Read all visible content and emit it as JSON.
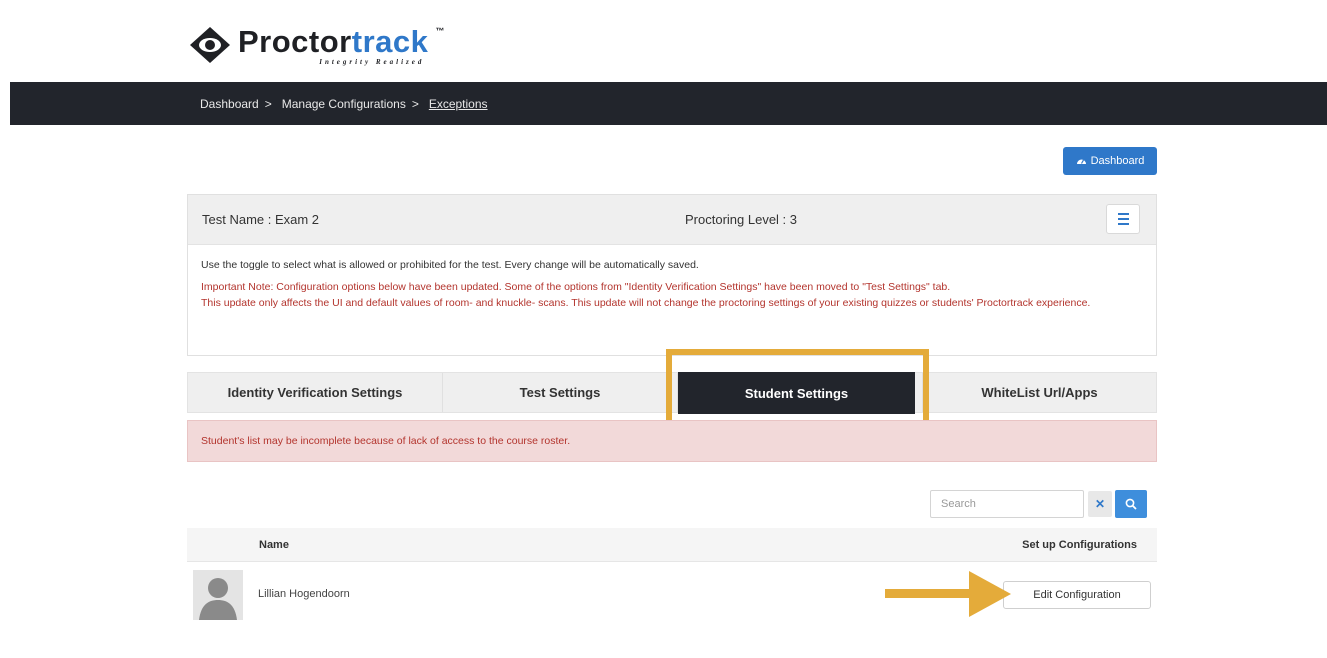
{
  "logo": {
    "word_dark": "Proctor",
    "word_accent": "track",
    "tm": "™",
    "tagline": "Integrity Realized"
  },
  "breadcrumb": [
    {
      "label": "Dashboard",
      "sep": ">"
    },
    {
      "label": "Manage Configurations",
      "sep": ">"
    },
    {
      "label": "Exceptions"
    }
  ],
  "dashboard_button": {
    "label": "Dashboard",
    "icon": "dashboard-icon"
  },
  "test": {
    "name": "Test Name : Exam 2",
    "proctoring_level": "Proctoring Level : 3"
  },
  "notes": {
    "toggle": "Use the toggle to select what is allowed or prohibited for the test. Every change will be automatically saved.",
    "important_line1": "Important Note: Configuration options below have been updated. Some of the options from \"Identity Verification Settings\" have been moved to \"Test Settings\" tab.",
    "important_line2": "This update only affects the UI and default values of room- and knuckle- scans. This update will not change the proctoring settings of your existing quizzes or students' Proctortrack experience."
  },
  "tabs": [
    {
      "label": "Identity Verification Settings",
      "active": false
    },
    {
      "label": "Test Settings",
      "active": false
    },
    {
      "label": "Student Settings",
      "active": true
    },
    {
      "label": "WhiteList Url/Apps",
      "active": false
    }
  ],
  "alert": "Student's list may be incomplete because of lack of access to the course roster.",
  "search": {
    "placeholder": "Search",
    "clear_icon": "close-icon",
    "search_icon": "search-icon"
  },
  "table": {
    "headers": {
      "name": "Name",
      "config": "Set up Configurations"
    },
    "rows": [
      {
        "name": "Lillian Hogendoorn",
        "action": "Edit Configuration"
      }
    ]
  },
  "colors": {
    "nav_dark": "#22252c",
    "accent_blue": "#2f78c9",
    "highlight": "#e4ab3a",
    "alert_text": "#b3342d",
    "alert_bg": "#f2d9d9"
  }
}
